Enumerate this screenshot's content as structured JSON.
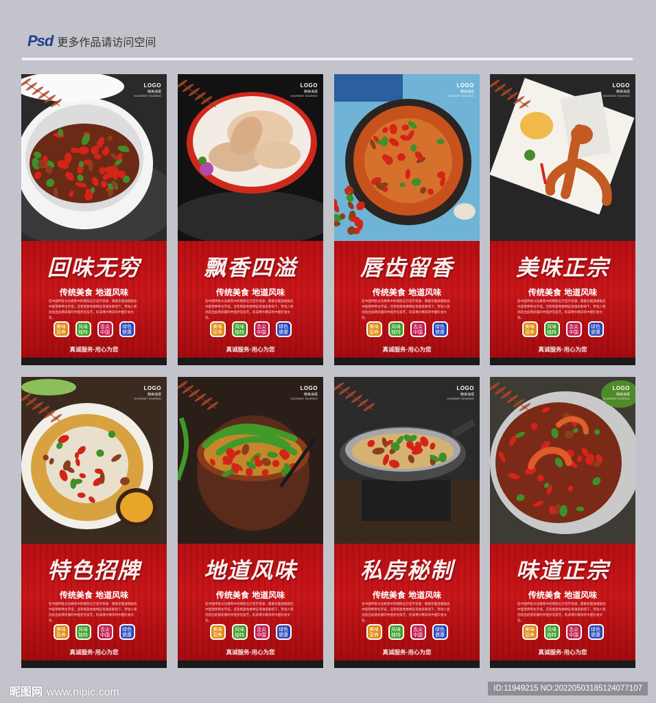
{
  "header": {
    "psd_label": "Psd",
    "text": "更多作品请访问空间"
  },
  "common": {
    "logo": "LOGO",
    "logo_cn": "精美海报",
    "logo_en": "GOURMET SHARING",
    "subtitle": "传统美食 地道风味",
    "body": "在中国传统文化教育中的阴阳五行哲学思想、儒家伦理道德观念中医营养养生学说，还有民族性格特征等诸多影响下，劳动人民创造出彪炳史册的中国烹饪技艺，形成博大精深的中国饮食文化。",
    "footer": "真诚服务·用心为您",
    "badges": [
      {
        "text": "美味营养",
        "color": "#e08a12"
      },
      {
        "text": "风味独特",
        "color": "#3f9e2a"
      },
      {
        "text": "舌尖中国",
        "color": "#c21a4f"
      },
      {
        "text": "绿色健康",
        "color": "#2743b8"
      }
    ]
  },
  "posters": [
    {
      "title": "回味无穷",
      "dish": "clay-pot-pepper-frog"
    },
    {
      "title": "飘香四溢",
      "dish": "plated-frog-legs"
    },
    {
      "title": "唇齿留香",
      "dish": "chili-frog-stew"
    },
    {
      "title": "美味正宗",
      "dish": "roasted-frog-fries"
    },
    {
      "title": "特色招牌",
      "dish": "frog-pepper-soup"
    },
    {
      "title": "地道风味",
      "dish": "green-chili-frog-bowl"
    },
    {
      "title": "私房秘制",
      "dish": "dry-pot-frog"
    },
    {
      "title": "味道正宗",
      "dish": "spicy-shrimp-frog"
    }
  ],
  "watermark": {
    "left_brand": "昵图网",
    "left_url": "www.nipic.com",
    "right": "ID:11949215 NO:20220503185124077107"
  }
}
